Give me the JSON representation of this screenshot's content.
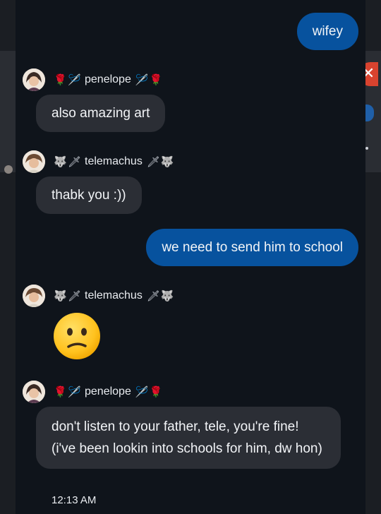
{
  "messages": [
    {
      "kind": "outgoing",
      "text": "wifey"
    },
    {
      "kind": "incoming",
      "sender": "penelope",
      "sender_emoji": [
        "rose",
        "needle",
        "needle",
        "rose"
      ],
      "text": "also amazing art"
    },
    {
      "kind": "incoming",
      "sender": "telemachus",
      "sender_emoji": [
        "wolf",
        "dagger",
        "dagger",
        "wolf"
      ],
      "text": "thabk you :))"
    },
    {
      "kind": "outgoing",
      "text": "we need to send him to school"
    },
    {
      "kind": "incoming",
      "sender": "telemachus",
      "sender_emoji": [
        "wolf",
        "dagger",
        "dagger",
        "wolf"
      ],
      "emoji": "confused-face"
    },
    {
      "kind": "incoming",
      "sender": "penelope",
      "sender_emoji": [
        "rose",
        "needle",
        "needle",
        "rose"
      ],
      "text": "don't listen to your father, tele, you're fine! (i've been lookin into schools for him, dw hon)",
      "timestamp": "12:13 AM"
    }
  ],
  "colors": {
    "outgoing_bubble": "#07529e",
    "incoming_bubble": "#2b2e35",
    "panel_background": "#0f141b"
  },
  "glyphs": {
    "rose": "🌹",
    "needle": "🪡",
    "wolf": "🐺",
    "dagger": "🗡"
  }
}
